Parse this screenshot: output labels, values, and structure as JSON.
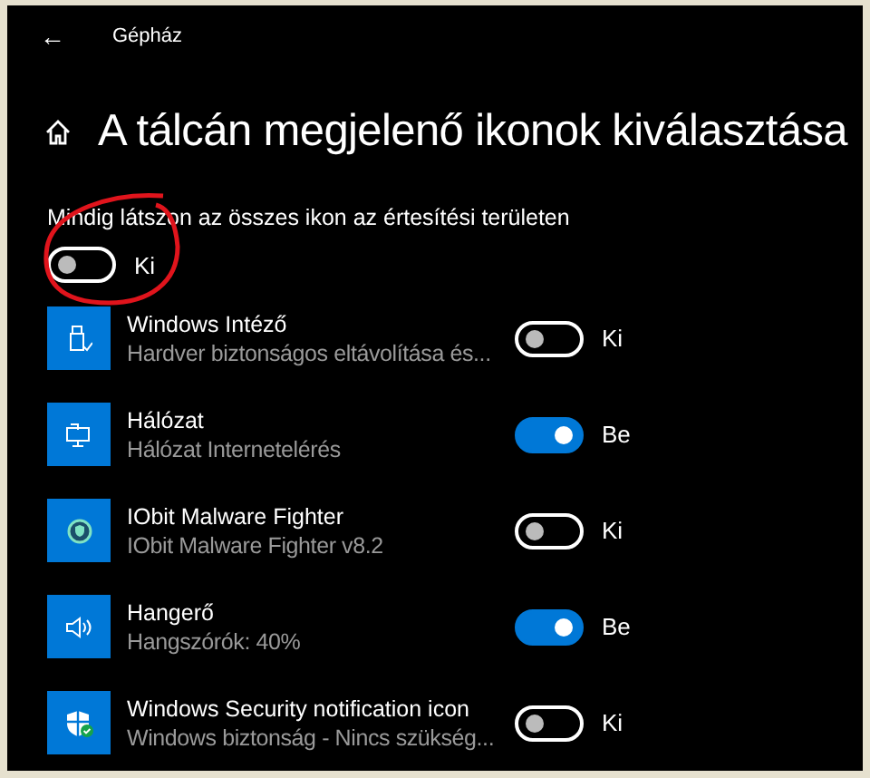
{
  "window": {
    "title": "Gépház",
    "back_glyph": "←"
  },
  "page": {
    "title": "A tálcán megjelenő ikonok kiválasztása"
  },
  "master": {
    "label": "Mindig látszon az összes ikon az értesítési területen",
    "on": false,
    "state_text": "Ki"
  },
  "items": [
    {
      "kind": "usb",
      "name": "Windows Intéző",
      "detail": "Hardver biztonságos eltávolítása és...",
      "on": false,
      "state_text": "Ki"
    },
    {
      "kind": "network",
      "name": "Hálózat",
      "detail": "Hálózat Internetelérés",
      "on": true,
      "state_text": "Be"
    },
    {
      "kind": "shield",
      "name": "IObit Malware Fighter",
      "detail": "IObit Malware Fighter v8.2",
      "on": false,
      "state_text": "Ki"
    },
    {
      "kind": "speaker",
      "name": "Hangerő",
      "detail": "Hangszórók: 40%",
      "on": true,
      "state_text": "Be"
    },
    {
      "kind": "security",
      "name": "Windows Security notification icon",
      "detail": "Windows biztonság - Nincs szükség...",
      "on": false,
      "state_text": "Ki"
    }
  ]
}
